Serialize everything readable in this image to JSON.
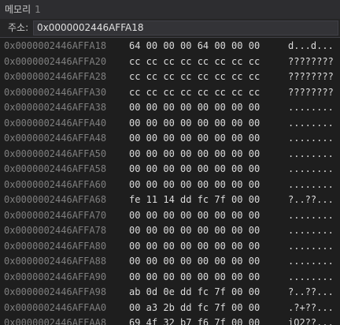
{
  "window": {
    "title": "메모리",
    "title_number": "1"
  },
  "address_bar": {
    "label": "주소:",
    "value": "0x0000002446AFFA18"
  },
  "rows": [
    {
      "address": "0x0000002446AFFA18",
      "bytes": "64 00 00 00 64 00 00 00",
      "ascii": "d...d..."
    },
    {
      "address": "0x0000002446AFFA20",
      "bytes": "cc cc cc cc cc cc cc cc",
      "ascii": "????????"
    },
    {
      "address": "0x0000002446AFFA28",
      "bytes": "cc cc cc cc cc cc cc cc",
      "ascii": "????????"
    },
    {
      "address": "0x0000002446AFFA30",
      "bytes": "cc cc cc cc cc cc cc cc",
      "ascii": "????????"
    },
    {
      "address": "0x0000002446AFFA38",
      "bytes": "00 00 00 00 00 00 00 00",
      "ascii": "........"
    },
    {
      "address": "0x0000002446AFFA40",
      "bytes": "00 00 00 00 00 00 00 00",
      "ascii": "........"
    },
    {
      "address": "0x0000002446AFFA48",
      "bytes": "00 00 00 00 00 00 00 00",
      "ascii": "........"
    },
    {
      "address": "0x0000002446AFFA50",
      "bytes": "00 00 00 00 00 00 00 00",
      "ascii": "........"
    },
    {
      "address": "0x0000002446AFFA58",
      "bytes": "00 00 00 00 00 00 00 00",
      "ascii": "........"
    },
    {
      "address": "0x0000002446AFFA60",
      "bytes": "00 00 00 00 00 00 00 00",
      "ascii": "........"
    },
    {
      "address": "0x0000002446AFFA68",
      "bytes": "fe 11 14 dd fc 7f 00 00",
      "ascii": "?..??..."
    },
    {
      "address": "0x0000002446AFFA70",
      "bytes": "00 00 00 00 00 00 00 00",
      "ascii": "........"
    },
    {
      "address": "0x0000002446AFFA78",
      "bytes": "00 00 00 00 00 00 00 00",
      "ascii": "........"
    },
    {
      "address": "0x0000002446AFFA80",
      "bytes": "00 00 00 00 00 00 00 00",
      "ascii": "........"
    },
    {
      "address": "0x0000002446AFFA88",
      "bytes": "00 00 00 00 00 00 00 00",
      "ascii": "........"
    },
    {
      "address": "0x0000002446AFFA90",
      "bytes": "00 00 00 00 00 00 00 00",
      "ascii": "........"
    },
    {
      "address": "0x0000002446AFFA98",
      "bytes": "ab 0d 0e dd fc 7f 00 00",
      "ascii": "?..??..."
    },
    {
      "address": "0x0000002446AFFAA0",
      "bytes": "00 a3 2b dd fc 7f 00 00",
      "ascii": ".?+??..."
    },
    {
      "address": "0x0000002446AFFAA8",
      "bytes": "69 4f 32 b7 f6 7f 00 00",
      "ascii": "iO2??..."
    }
  ]
}
